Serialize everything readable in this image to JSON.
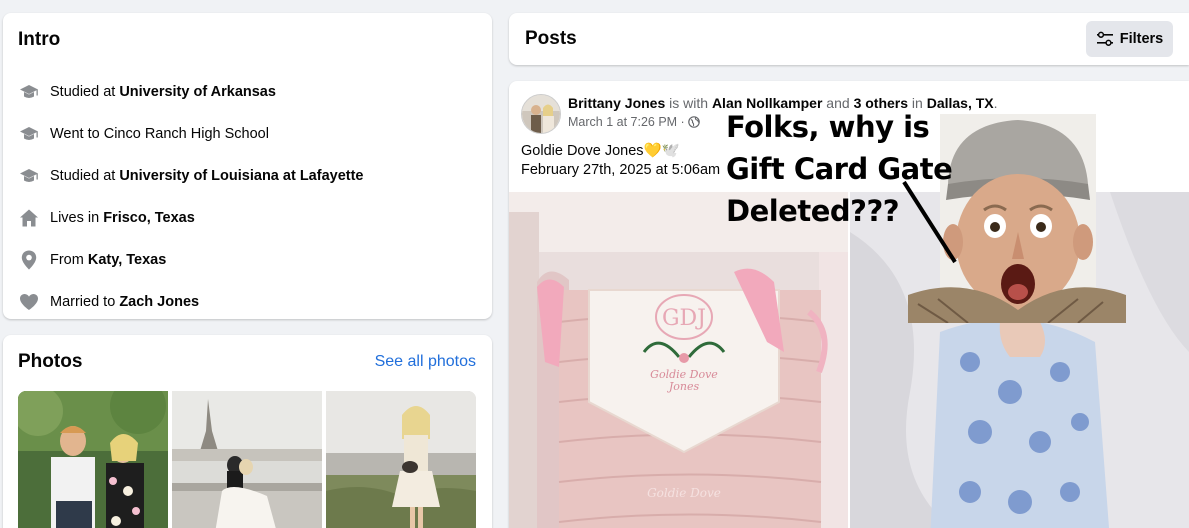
{
  "intro": {
    "title": "Intro",
    "items": [
      {
        "icon": "graduation-cap-icon",
        "prefix": "Studied at ",
        "bold": "University of Arkansas"
      },
      {
        "icon": "graduation-cap-icon",
        "prefix": "Went to Cinco Ranch High School",
        "bold": ""
      },
      {
        "icon": "graduation-cap-icon",
        "prefix": "Studied at ",
        "bold": "University of Louisiana at Lafayette"
      },
      {
        "icon": "home-icon",
        "prefix": "Lives in ",
        "bold": "Frisco, Texas"
      },
      {
        "icon": "location-pin-icon",
        "prefix": "From ",
        "bold": "Katy, Texas"
      },
      {
        "icon": "heart-icon",
        "prefix": "Married to ",
        "bold": "Zach Jones"
      }
    ]
  },
  "photos": {
    "title": "Photos",
    "see_all": "See all photos"
  },
  "posts": {
    "title": "Posts",
    "filters_label": "Filters"
  },
  "post": {
    "author": "Brittany Jones",
    "with_text": " is with ",
    "tagged": "Alan Nollkamper",
    "and_text": " and ",
    "others": "3 others",
    "in_text": " in ",
    "location": "Dallas, TX",
    "period": ".",
    "date": "March 1 at 7:26 PM",
    "dot": " · ",
    "line1": "Goldie Dove Jones💛🕊️",
    "line2": "February 27th, 2025 at 5:06am"
  },
  "overlay": {
    "line1": "Folks, why is",
    "line2": "Gift Card Gate",
    "line3": "Deleted???"
  },
  "colors": {
    "link_blue": "#216fdb",
    "secondary_text": "#65676b",
    "button_bg": "#e4e6eb",
    "page_bg": "#f0f2f5"
  }
}
